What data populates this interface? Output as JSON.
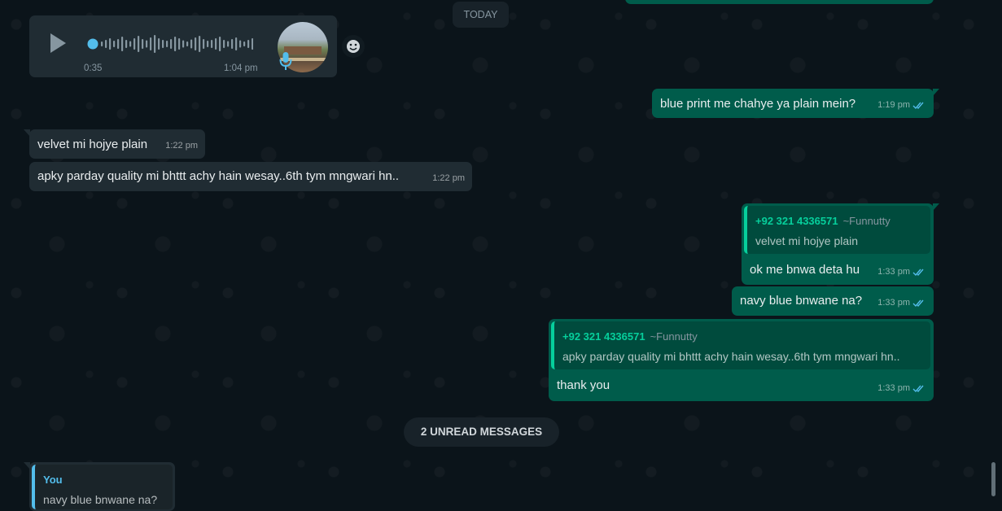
{
  "date_divider": "TODAY",
  "unread_divider": "2 UNREAD MESSAGES",
  "voice_note": {
    "duration": "0:35",
    "time": "1:04 pm",
    "icon": "play-icon",
    "progress": 0
  },
  "messages": [
    {
      "direction": "out",
      "text": "blue print me chahye ya plain mein?",
      "time": "1:19 pm"
    },
    {
      "direction": "in",
      "text": "velvet mi hojye plain",
      "time": "1:22 pm"
    },
    {
      "direction": "in",
      "text": "apky parday quality mi bhttt achy hain wesay..6th tym mngwari hn..",
      "time": "1:22 pm"
    },
    {
      "direction": "out",
      "text": "ok me bnwa deta hu",
      "time": "1:33 pm",
      "quote": {
        "sender": "+92 321 4336571",
        "alias": "~Funnutty",
        "text": "velvet mi hojye plain"
      }
    },
    {
      "direction": "out",
      "text": "navy blue bnwane na?",
      "time": "1:33 pm"
    },
    {
      "direction": "out",
      "text": "thank you",
      "time": "1:33 pm",
      "quote": {
        "sender": "+92 321 4336571",
        "alias": "~Funnutty",
        "text": "apky parday quality mi bhttt achy hain wesay..6th tym mngwari hn.."
      }
    }
  ],
  "last_quote": {
    "sender": "You",
    "text": "navy blue bnwane na?"
  },
  "colors": {
    "background": "#0b141a",
    "incoming_bubble": "#202c33",
    "outgoing_bubble": "#005c4b",
    "quote_accent": "#06cf9c",
    "read_ticks": "#53bdeb",
    "you_accent": "#53bdeb"
  }
}
